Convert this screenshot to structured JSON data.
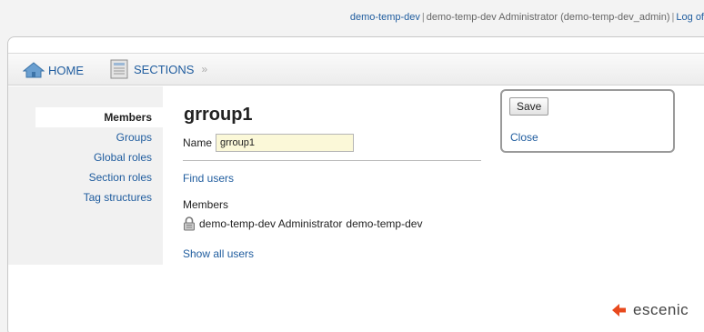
{
  "userbar": {
    "user_link": "demo-temp-dev",
    "separator": "|",
    "user_info": "demo-temp-dev Administrator (demo-temp-dev_admin)",
    "logout": "Log of"
  },
  "nav": {
    "home": "HOME",
    "sections": "SECTIONS",
    "crumb_sep": "»"
  },
  "leftmenu": {
    "items": [
      {
        "label": "Members"
      },
      {
        "label": "Groups"
      },
      {
        "label": "Global roles"
      },
      {
        "label": "Section roles"
      },
      {
        "label": "Tag structures"
      }
    ]
  },
  "main": {
    "title": "grroup1",
    "name_label": "Name",
    "name_value": "grroup1",
    "find_users": "Find users",
    "members_label": "Members",
    "member_name": "demo-temp-dev Administrator",
    "member_user": "demo-temp-dev",
    "show_all": "Show all users"
  },
  "actions": {
    "save": "Save",
    "close": "Close"
  },
  "brand": {
    "name": "escenic"
  },
  "colors": {
    "link": "#1f5c9e",
    "brand_accent": "#e8491d",
    "input_bg": "#fbf8d8"
  }
}
